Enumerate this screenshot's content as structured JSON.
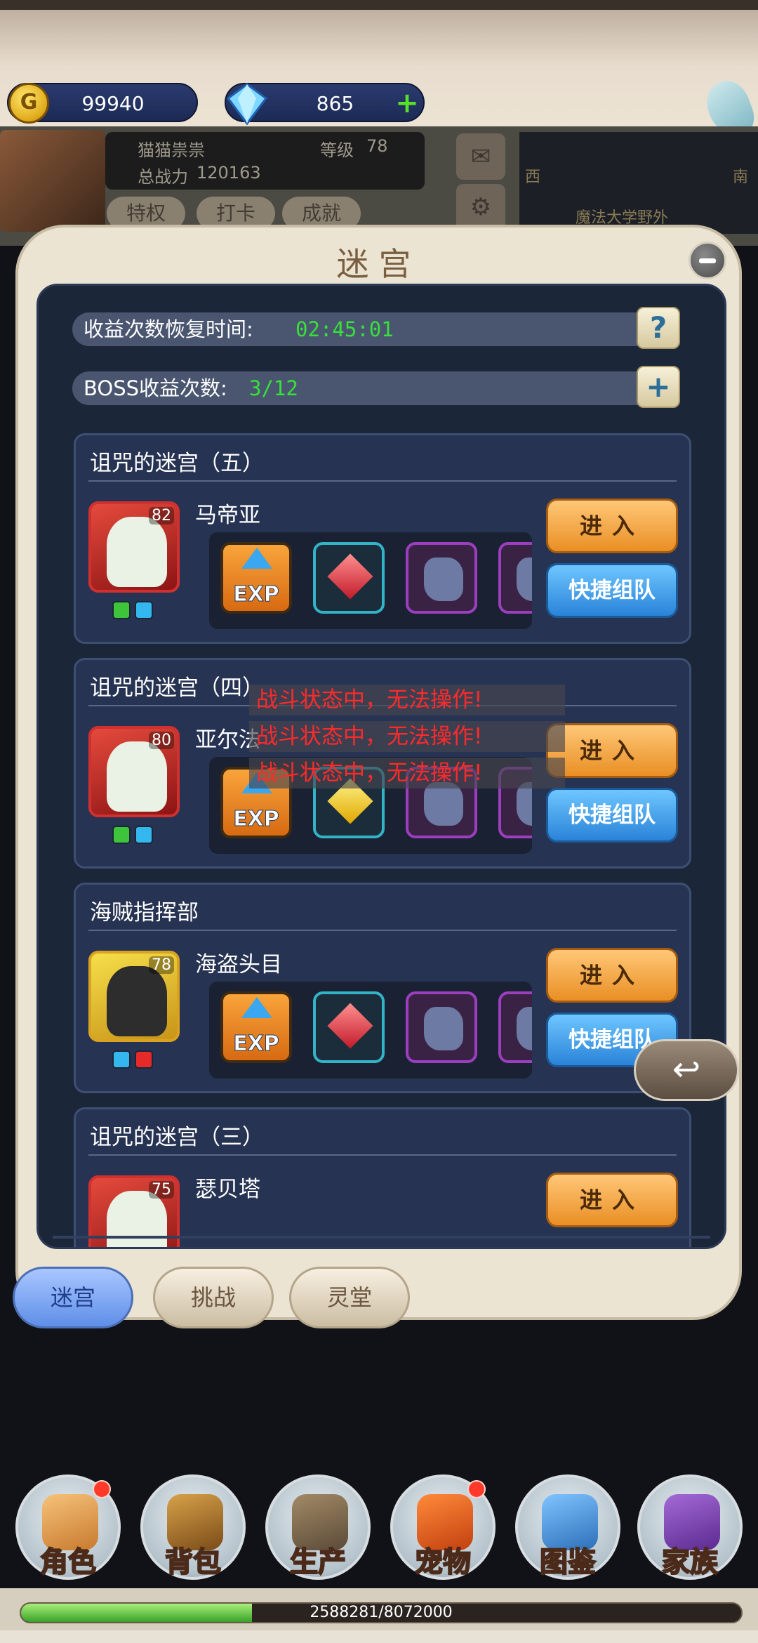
{
  "currency": {
    "gold_symbol": "G",
    "gold": "99940",
    "gems": "865"
  },
  "player": {
    "name": "猫猫祟祟",
    "level_label": "等级",
    "level": "78",
    "power_label": "总战力",
    "power": "120163",
    "buttons": [
      "特权",
      "打卡",
      "成就"
    ]
  },
  "map": {
    "west": "西",
    "south": "南",
    "location": "魔法大学野外"
  },
  "modal": {
    "title": "迷宫",
    "recovery_label": "收益次数恢复时间:",
    "recovery_time": "02:45:01",
    "help_symbol": "?",
    "boss_label": "BOSS收益次数:",
    "boss_count": "3/12",
    "add_symbol": "+"
  },
  "cards": [
    {
      "title": "诅咒的迷宫（五）",
      "boss": "马帝亚",
      "level": "82",
      "enter": "进入",
      "team": "快捷组队",
      "exp_label": "EXP"
    },
    {
      "title": "诅咒的迷宫（四）",
      "boss": "亚尔法",
      "level": "80",
      "enter": "进入",
      "team": "快捷组队",
      "exp_label": "EXP"
    },
    {
      "title": "海贼指挥部",
      "boss": "海盗头目",
      "level": "78",
      "enter": "进入",
      "team": "快捷组队",
      "exp_label": "EXP"
    },
    {
      "title": "诅咒的迷宫（三）",
      "boss": "瑟贝塔",
      "level": "75",
      "enter": "进入"
    }
  ],
  "warnings": [
    "战斗状态中，无法操作!",
    "战斗状态中，无法操作!",
    "战斗状态中，无法操作!"
  ],
  "tabs": [
    "迷宫",
    "挑战",
    "灵堂"
  ],
  "bottom_nav": [
    "角色",
    "背包",
    "生产",
    "宠物",
    "图鉴",
    "家族"
  ],
  "experience": {
    "text": "2588281/8072000",
    "fraction": 0.3206
  },
  "colors": {
    "accent_green": "#38e03a",
    "warning_red": "#ff2a2a",
    "enter_orange": "#e98f25",
    "team_blue": "#2a83d8"
  }
}
